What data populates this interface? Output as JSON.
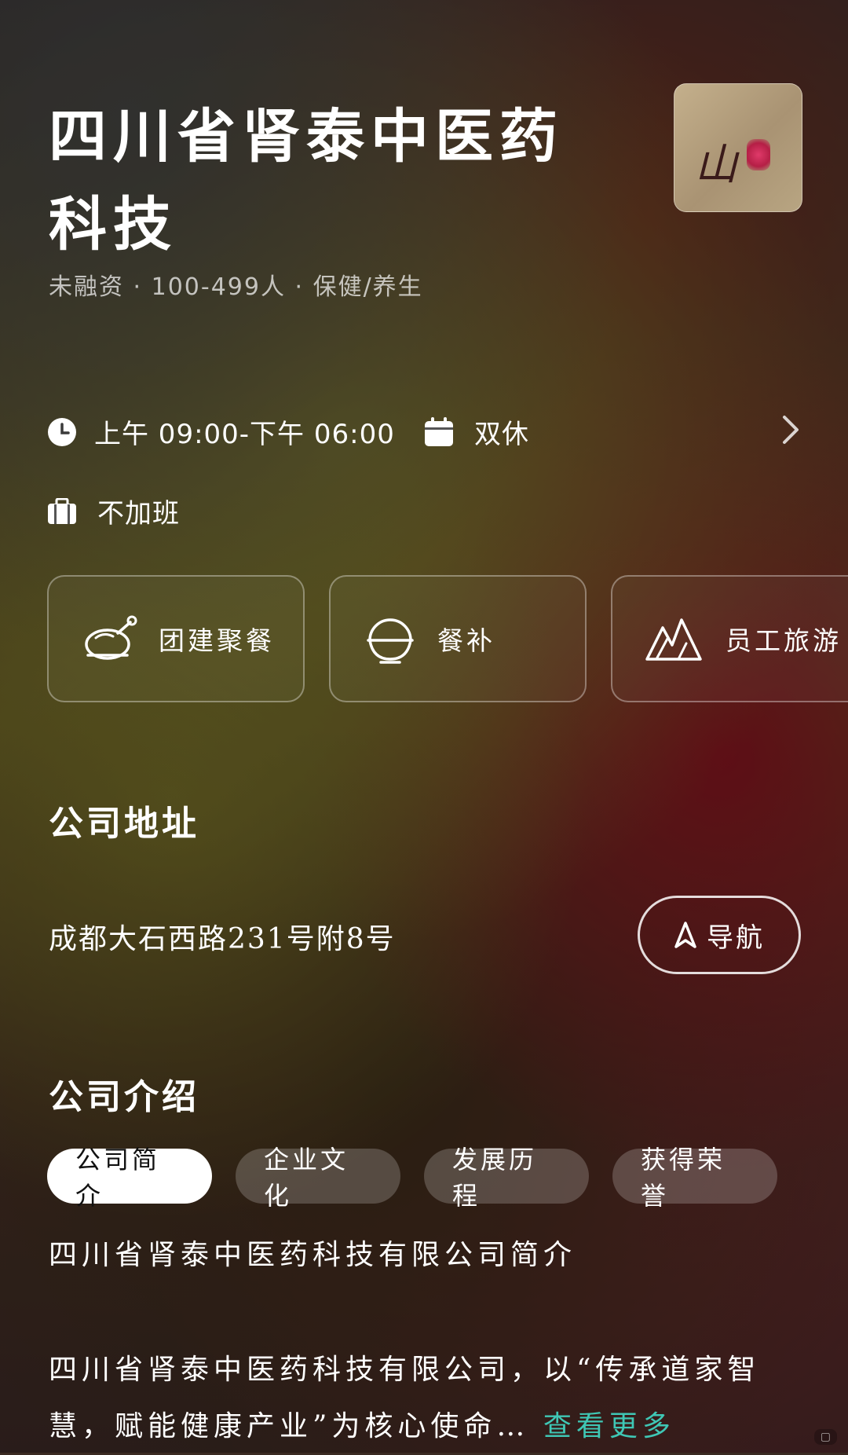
{
  "company": {
    "name": "四川省肾泰中医药科技",
    "meta": "未融资 · 100-499人 · 保健/养生"
  },
  "work": {
    "hours": "上午 09:00-下午 06:00",
    "rest": "双休",
    "overtime": "不加班"
  },
  "welfare": [
    {
      "label": "团建聚餐",
      "icon": "roast-chicken-icon"
    },
    {
      "label": "餐补",
      "icon": "rice-bowl-icon"
    },
    {
      "label": "员工旅游",
      "icon": "mountains-icon"
    }
  ],
  "address": {
    "title": "公司地址",
    "text": "成都大石西路231号附8号",
    "nav_label": "导航"
  },
  "intro": {
    "title": "公司介绍",
    "tabs": [
      "公司简介",
      "企业文化",
      "发展历程",
      "获得荣誉"
    ],
    "active_tab": 0,
    "heading": "四川省肾泰中医药科技有限公司简介",
    "body": "四川省肾泰中医药科技有限公司，以“传承道家智慧，赋能健康产业”为核心使命…",
    "see_more": "查看更多"
  },
  "colors": {
    "accent": "#3fc7b5",
    "active_tab_bg": "#ffffff"
  }
}
